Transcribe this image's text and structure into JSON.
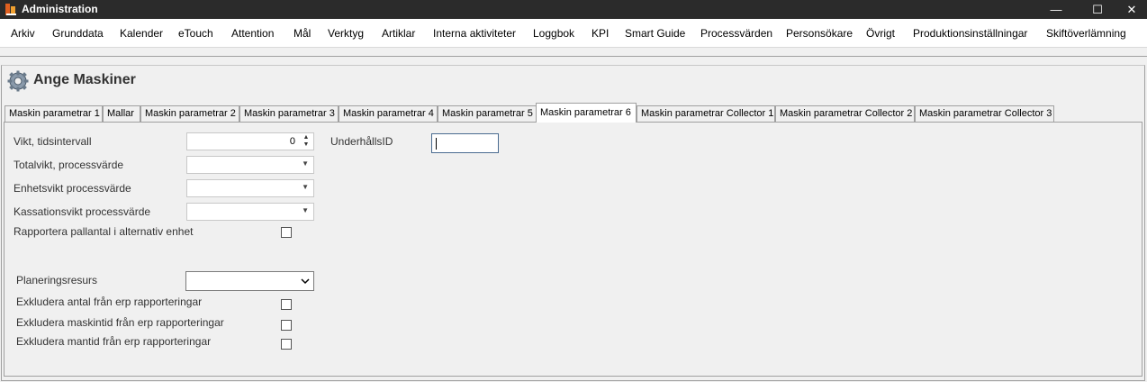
{
  "window": {
    "title": "Administration"
  },
  "menu": [
    "Arkiv",
    "Grunddata",
    "Kalender",
    "eTouch",
    "Attention",
    "Mål",
    "Verktyg",
    "Artiklar",
    "Interna aktiviteter",
    "Loggbok",
    "KPI",
    "Smart Guide",
    "Processvärden",
    "Personsökare",
    "Övrigt",
    "Produktionsinställningar",
    "Skiftöverlämning"
  ],
  "page": {
    "title": "Ange Maskiner"
  },
  "tabs": [
    "Maskin parametrar 1",
    "Mallar",
    "Maskin parametrar 2",
    "Maskin parametrar 3",
    "Maskin parametrar 4",
    "Maskin parametrar 5",
    "Maskin parametrar 6",
    "Maskin parametrar Collector 1",
    "Maskin parametrar Collector 2",
    "Maskin parametrar Collector 3"
  ],
  "active_tab": "Maskin parametrar 6",
  "form": {
    "vikt_label": "Vikt, tidsintervall",
    "vikt_value": "0",
    "totalvikt_label": "Totalvikt, processvärde",
    "enhetsvikt_label": "Enhetsvikt processvärde",
    "kassationsvikt_label": "Kassationsvikt processvärde",
    "rapportera_label": "Rapportera pallantal i alternativ enhet",
    "planering_label": "Planeringsresurs",
    "excl_antal_label": "Exkludera antal från erp rapporteringar",
    "excl_maskintid_label": "Exkludera maskintid från erp rapporteringar",
    "excl_mantid_label": "Exkludera mantid från erp rapporteringar",
    "underhall_label": "UnderhållsID",
    "underhall_value": ""
  },
  "icons": {
    "app": "app-logo-icon",
    "header": "gear-icon"
  },
  "colors": {
    "titlebar": "#2b2b2b",
    "menubar": "#ffffff",
    "panel": "#f0f0f0",
    "border": "#a0a0a0"
  }
}
